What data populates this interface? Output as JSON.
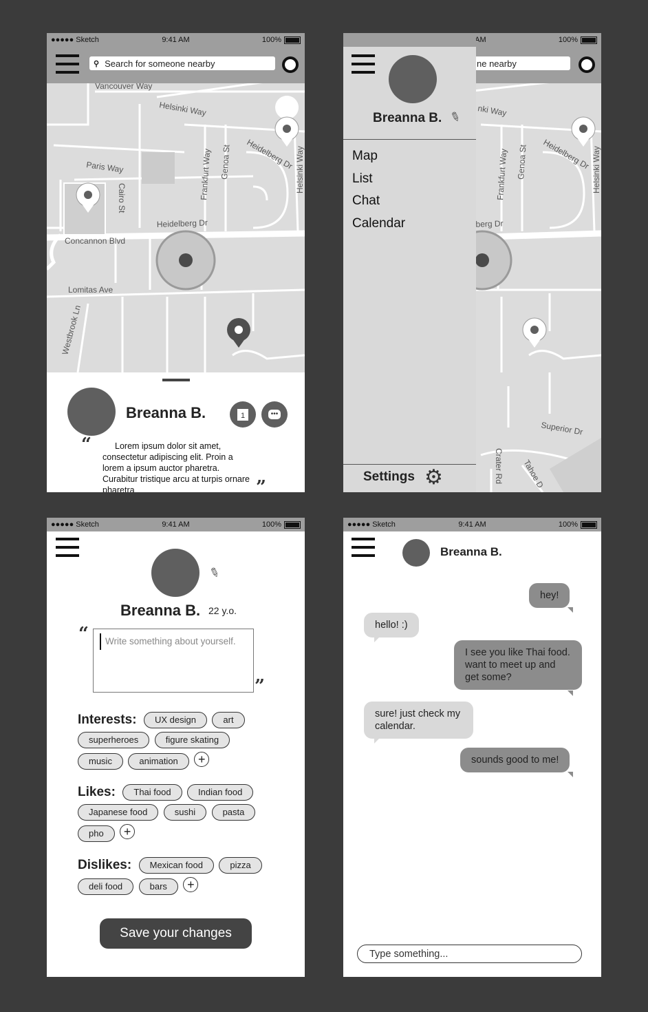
{
  "status": {
    "carrier": "●●●●● Sketch",
    "time": "9:41 AM",
    "battery": "100%"
  },
  "map_screen": {
    "search_placeholder": "Search for someone nearby",
    "streets": [
      "Vancouver Way",
      "Helsinki Way",
      "Paris Way",
      "Cairo St",
      "Frankfurt Way",
      "Genoa St",
      "Heidelberg Dr",
      "Helsinki Way",
      "Heidelberg Dr",
      "Concannon Blvd",
      "Lomitas Ave",
      "Westbrook Ln"
    ],
    "profile_name": "Breanna B.",
    "calendar_day": "1",
    "chat_glyph": "•••",
    "bio": "Lorem ipsum dolor sit amet, consectetur adipiscing elit. Proin a lorem a ipsum auctor pharetra. Curabitur tristique arcu at turpis ornare pharetra"
  },
  "drawer_screen": {
    "search_partial": "ne nearby",
    "user_name": "Breanna B.",
    "menu": [
      "Map",
      "List",
      "Chat",
      "Calendar"
    ],
    "settings_label": "Settings",
    "streets": [
      "nki Way",
      "Frankfurt Way",
      "Genoa St",
      "Heidelberg Dr",
      "Helsinki Way",
      "lberg Dr",
      "Superior Dr",
      "Crater Rd",
      "Tahoe D"
    ]
  },
  "profile_screen": {
    "name": "Breanna B.",
    "age": "22 y.o.",
    "bio_placeholder": "Write something about yourself.",
    "interests_label": "Interests:",
    "interests": [
      "UX design",
      "art",
      "superheroes",
      "figure skating",
      "music",
      "animation"
    ],
    "likes_label": "Likes:",
    "likes": [
      "Thai food",
      "Indian food",
      "Japanese food",
      "sushi",
      "pasta",
      "pho"
    ],
    "dislikes_label": "Dislikes:",
    "dislikes": [
      "Mexican food",
      "pizza",
      "deli food",
      "bars"
    ],
    "save_label": "Save your changes"
  },
  "chat_screen": {
    "name": "Breanna B.",
    "messages": [
      {
        "from": "me",
        "text": "hey!"
      },
      {
        "from": "them",
        "text": "hello! :)"
      },
      {
        "from": "me",
        "text": "I see you like Thai food. want to meet up and get some?"
      },
      {
        "from": "them",
        "text": "sure! just check my calendar."
      },
      {
        "from": "me",
        "text": "sounds good to me!"
      }
    ],
    "input_placeholder": "Type something..."
  },
  "colors": {
    "background": "#3b3b3b",
    "bar_grey": "#9e9e9e",
    "dark_grey": "#5f5f5f",
    "map": "#dcdcdc"
  }
}
